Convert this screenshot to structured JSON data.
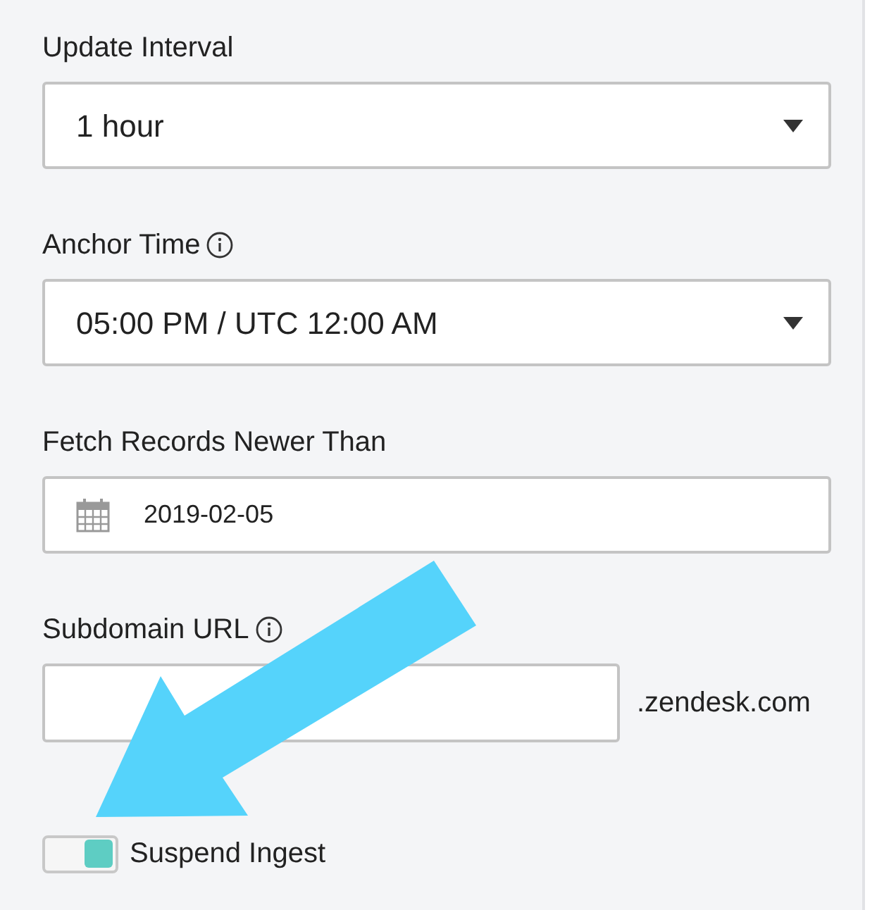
{
  "fields": [
    {
      "kind": "select",
      "label": "Update Interval",
      "info": false,
      "value": "1 hour"
    },
    {
      "kind": "select",
      "label": "Anchor Time",
      "info": true,
      "value": "05:00 PM / UTC 12:00 AM"
    },
    {
      "kind": "date",
      "label": "Fetch Records Newer Than",
      "info": false,
      "value": "2019-02-05"
    },
    {
      "kind": "text",
      "label": "Subdomain URL",
      "info": true,
      "suffix": ".zendesk.com"
    }
  ],
  "toggle": {
    "label": "Suspend Ingest",
    "on": true
  }
}
